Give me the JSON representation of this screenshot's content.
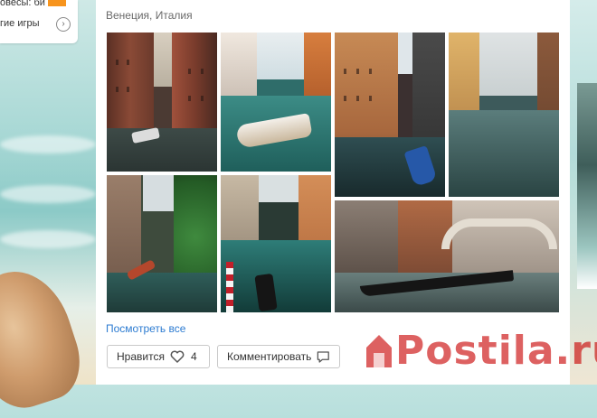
{
  "left_widget": {
    "line1": "овесы: би",
    "line2": "гие игры",
    "more_icon": "chevron-right-circle-icon"
  },
  "post": {
    "location": "Венеция, Италия",
    "photos": [
      {
        "name": "photo-canal-1",
        "scene": "narrow canal with boats and brick houses"
      },
      {
        "name": "photo-canal-2",
        "scene": "motorboat on green canal"
      },
      {
        "name": "photo-canal-3",
        "scene": "canal with blue boat and arched facades"
      },
      {
        "name": "photo-canal-4",
        "scene": "wide canal with bridges in distance"
      },
      {
        "name": "photo-canal-5",
        "scene": "narrow canal with tree and gondolas"
      },
      {
        "name": "photo-canal-6",
        "scene": "canal with striped poles and gondolas"
      },
      {
        "name": "photo-canal-7",
        "scene": "bridge with moored gondolas"
      }
    ],
    "see_all": "Посмотреть все",
    "like_label": "Нравится",
    "like_count": "4",
    "like_icon": "heart-icon",
    "comment_label": "Комментировать",
    "comment_icon": "comment-bubble-icon"
  },
  "watermark": {
    "text": "Postila.ru",
    "icon": "house-logo",
    "color": "#c80000"
  }
}
